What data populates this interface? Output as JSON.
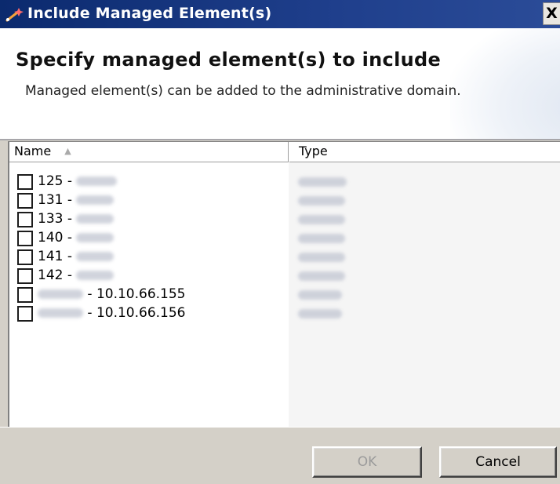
{
  "window": {
    "title": "Include Managed Element(s)",
    "close_glyph": "X",
    "icon": "wand-sparkle-icon"
  },
  "header": {
    "heading": "Specify managed element(s) to include",
    "description": "Managed element(s) can be added to the administrative domain."
  },
  "list": {
    "columns": {
      "name": "Name",
      "type": "Type"
    },
    "sort_indicator": "▲",
    "rows": [
      {
        "name": "125 - ",
        "checked": false
      },
      {
        "name": "131 - ",
        "checked": false
      },
      {
        "name": "133 - ",
        "checked": false
      },
      {
        "name": "140 - ",
        "checked": false
      },
      {
        "name": "141 - ",
        "checked": false
      },
      {
        "name": "142 - ",
        "checked": false
      },
      {
        "name_suffix": " - 10.10.66.155",
        "checked": false
      },
      {
        "name_suffix": " - 10.10.66.156",
        "checked": false
      }
    ]
  },
  "buttons": {
    "ok": "OK",
    "cancel": "Cancel"
  },
  "colors": {
    "titlebar": "#0b2a6e",
    "dialog_bg": "#d4d0c8",
    "disabled_text": "#9b9b9b"
  }
}
